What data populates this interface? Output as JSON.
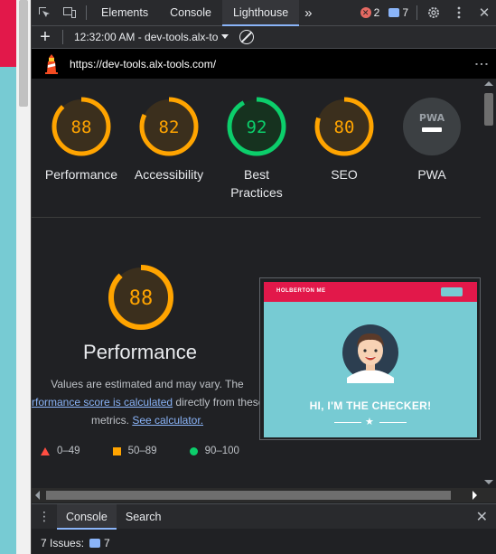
{
  "toolbar": {
    "tabs": [
      {
        "label": "Elements"
      },
      {
        "label": "Console"
      },
      {
        "label": "Lighthouse"
      }
    ],
    "more_tabs": "»",
    "error_count": "2",
    "message_count": "7"
  },
  "report_bar": {
    "add": "+",
    "selected_report": "12:32:00 AM - dev-tools.alx-to"
  },
  "url_bar": {
    "url": "https://dev-tools.alx-tools.com/"
  },
  "scores": [
    {
      "label": "Performance",
      "value": 88,
      "color": "#ffa400"
    },
    {
      "label": "Accessibility",
      "value": 82,
      "color": "#ffa400"
    },
    {
      "label": "Best Practices",
      "value": 92,
      "color": "#0cce6b"
    },
    {
      "label": "SEO",
      "value": 80,
      "color": "#ffa400"
    },
    {
      "label": "PWA",
      "value": null,
      "color": "#9aa0a6"
    }
  ],
  "performance": {
    "score": "88",
    "score_value": 88,
    "title": "Performance",
    "note_line1": "Values are estimated and may vary. The",
    "note_link1": "rformance score is calculated",
    "note_mid": "directly from these",
    "note_line3": "metrics.",
    "note_link2": "See calculator.",
    "legend": [
      {
        "range": "0–49",
        "color": "#ff4e42"
      },
      {
        "range": "50–89",
        "color": "#ffa400"
      },
      {
        "range": "90–100",
        "color": "#0cce6b"
      }
    ]
  },
  "screenshot": {
    "brand": "HOLBERTON ME",
    "headline": "HI, I'M THE CHECKER!"
  },
  "drawer": {
    "tabs": [
      {
        "label": "Console"
      },
      {
        "label": "Search"
      }
    ],
    "issues_label": "7 Issues:",
    "issues_count": "7"
  },
  "colors": {
    "accent": "#8ab4f8",
    "pass": "#0cce6b",
    "average": "#ffa400",
    "fail": "#ff4e42",
    "page_teal": "#77cbd3",
    "page_red": "#e2184a"
  }
}
